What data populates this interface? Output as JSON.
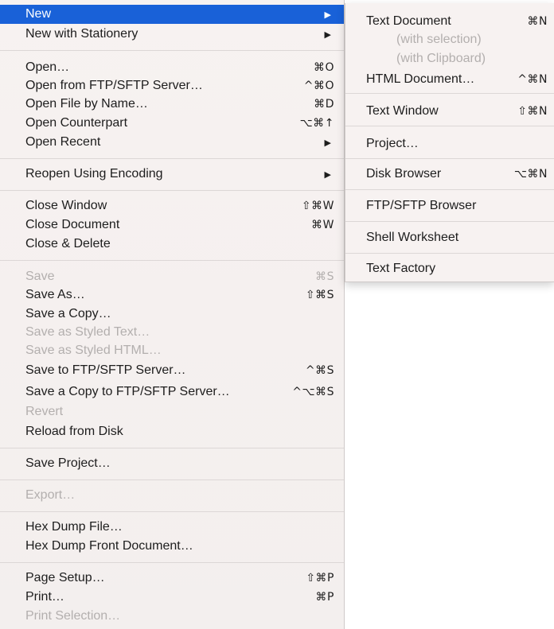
{
  "menu": {
    "items": [
      {
        "label": "New",
        "shortcut": "",
        "arrow": "▶",
        "selected": true
      },
      {
        "label": "New with Stationery",
        "shortcut": "",
        "arrow": "▶"
      },
      {
        "label": "Open…",
        "shortcut": "⌘O"
      },
      {
        "label": "Open from FTP/SFTP Server…",
        "shortcut": "^⌘O"
      },
      {
        "label": "Open File by Name…",
        "shortcut": "⌘D"
      },
      {
        "label": "Open Counterpart",
        "shortcut": "⌥⌘↑"
      },
      {
        "label": "Open Recent",
        "shortcut": "",
        "arrow": "▶"
      },
      {
        "label": "Reopen Using Encoding",
        "shortcut": "",
        "arrow": "▶"
      },
      {
        "label": "Close Window",
        "shortcut": "⇧⌘W"
      },
      {
        "label": "Close Document",
        "shortcut": "⌘W"
      },
      {
        "label": "Close & Delete",
        "shortcut": ""
      },
      {
        "label": "Save",
        "shortcut": "⌘S",
        "disabled": true
      },
      {
        "label": "Save As…",
        "shortcut": "⇧⌘S"
      },
      {
        "label": "Save a Copy…",
        "shortcut": ""
      },
      {
        "label": "Save as Styled Text…",
        "shortcut": "",
        "disabled": true
      },
      {
        "label": "Save as Styled HTML…",
        "shortcut": "",
        "disabled": true
      },
      {
        "label": "Save to FTP/SFTP Server…",
        "shortcut": "^⌘S"
      },
      {
        "label": "Save a Copy to FTP/SFTP Server…",
        "shortcut": "^⌥⌘S"
      },
      {
        "label": "Revert",
        "shortcut": "",
        "disabled": true
      },
      {
        "label": "Reload from Disk",
        "shortcut": ""
      },
      {
        "label": "Save Project…",
        "shortcut": ""
      },
      {
        "label": "Export…",
        "shortcut": "",
        "disabled": true
      },
      {
        "label": "Hex Dump File…",
        "shortcut": ""
      },
      {
        "label": "Hex Dump Front Document…",
        "shortcut": ""
      },
      {
        "label": "Page Setup…",
        "shortcut": "⇧⌘P"
      },
      {
        "label": "Print…",
        "shortcut": "⌘P"
      },
      {
        "label": "Print Selection…",
        "shortcut": "",
        "disabled": true
      }
    ]
  },
  "submenu": {
    "items": [
      {
        "label": "Text Document",
        "shortcut": "⌘N"
      },
      {
        "label": "(with selection)",
        "shortcut": "",
        "disabled": true
      },
      {
        "label": "(with Clipboard)",
        "shortcut": "",
        "disabled": true
      },
      {
        "label": "HTML Document…",
        "shortcut": "^⌘N"
      },
      {
        "label": "Text Window",
        "shortcut": "⇧⌘N"
      },
      {
        "label": "Project…",
        "shortcut": ""
      },
      {
        "label": "Disk Browser",
        "shortcut": "⌥⌘N"
      },
      {
        "label": "FTP/SFTP Browser",
        "shortcut": ""
      },
      {
        "label": "Shell Worksheet",
        "shortcut": ""
      },
      {
        "label": "Text Factory",
        "shortcut": ""
      }
    ]
  },
  "colors": {
    "selection": "#1961d8",
    "disabled_text": "#b3afae",
    "menu_background": "#f7f2f1"
  }
}
